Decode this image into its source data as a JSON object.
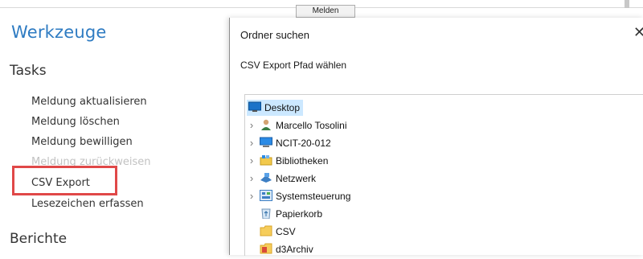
{
  "behind_button": {
    "label": "Melden"
  },
  "sidebar": {
    "title": "Werkzeuge",
    "sections": [
      {
        "label": "Tasks"
      },
      {
        "label": "Berichte"
      }
    ],
    "tasks": [
      {
        "label": "Meldung aktualisieren",
        "enabled": true
      },
      {
        "label": "Meldung löschen",
        "enabled": true
      },
      {
        "label": "Meldung bewilligen",
        "enabled": true
      },
      {
        "label": "Meldung zurückweisen",
        "enabled": false
      },
      {
        "label": "CSV Export",
        "enabled": true,
        "highlighted": true
      },
      {
        "label": "Lesezeichen erfassen",
        "enabled": true
      }
    ],
    "highlight_color": "#e04848",
    "title_color": "#2e7bc2"
  },
  "dialog": {
    "title": "Ordner suchen",
    "close_symbol": "✕",
    "message": "CSV Export Pfad wählen",
    "tree": [
      {
        "label": "Desktop",
        "icon": "desktop-icon",
        "expandable": false,
        "selected": true,
        "depth": 0
      },
      {
        "label": "Marcello Tosolini",
        "icon": "user-icon",
        "expandable": true,
        "depth": 1
      },
      {
        "label": "NCIT-20-012",
        "icon": "computer-icon",
        "expandable": true,
        "depth": 1
      },
      {
        "label": "Bibliotheken",
        "icon": "library-icon",
        "expandable": true,
        "depth": 1
      },
      {
        "label": "Netzwerk",
        "icon": "network-icon",
        "expandable": true,
        "depth": 1
      },
      {
        "label": "Systemsteuerung",
        "icon": "control-panel-icon",
        "expandable": true,
        "depth": 1
      },
      {
        "label": "Papierkorb",
        "icon": "recycle-bin-icon",
        "expandable": false,
        "depth": 1
      },
      {
        "label": "CSV",
        "icon": "folder-icon",
        "expandable": false,
        "depth": 1
      },
      {
        "label": "d3Archiv",
        "icon": "archive-icon",
        "expandable": false,
        "depth": 1
      }
    ]
  }
}
